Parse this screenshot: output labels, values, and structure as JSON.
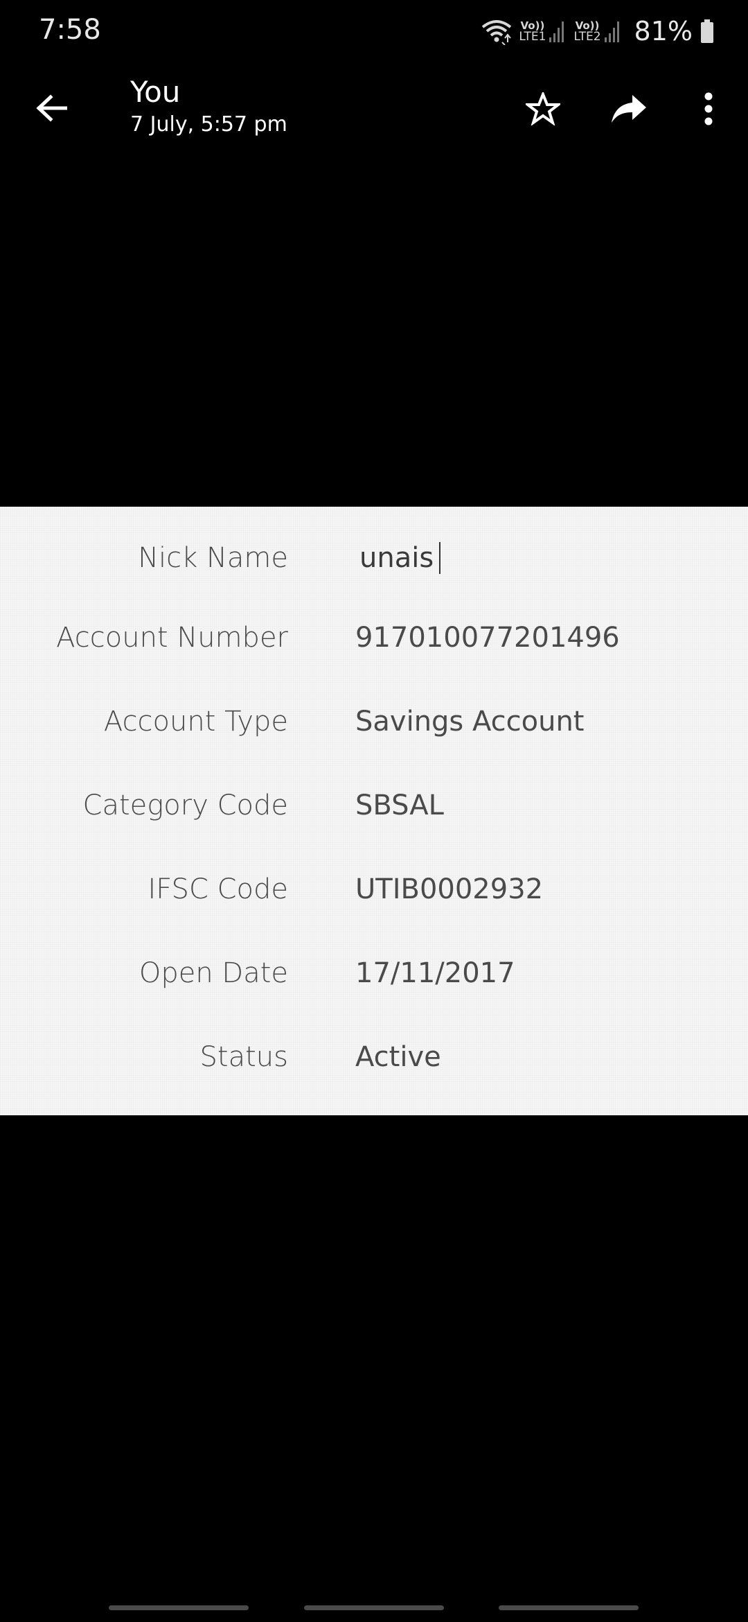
{
  "status_bar": {
    "time": "7:58",
    "sim1_vo": "Vo))",
    "sim1_lte": "LTE1",
    "sim2_vo": "Vo))",
    "sim2_lte": "LTE2",
    "battery": "81%",
    "icons": [
      "wifi-icon",
      "signal-icon",
      "signal-icon",
      "battery-icon"
    ]
  },
  "toolbar": {
    "sender": "You",
    "timestamp": "7 July, 5:57 pm",
    "icons": [
      "back-arrow-icon",
      "star-icon",
      "share-icon",
      "more-vert-icon"
    ]
  },
  "details": {
    "nick_name": {
      "label": "Nick Name",
      "value": "unais"
    },
    "rows": [
      {
        "label": "Account Number",
        "value": "917010077201496"
      },
      {
        "label": "Account Type",
        "value": "Savings Account"
      },
      {
        "label": "Category Code",
        "value": "SBSAL"
      },
      {
        "label": "IFSC Code",
        "value": "UTIB0002932"
      },
      {
        "label": "Open Date",
        "value": "17/11/2017"
      },
      {
        "label": "Status",
        "value": "Active"
      }
    ]
  },
  "colors": {
    "background": "#000000",
    "card": "#f6f6f6",
    "text_dark": "#4a4a4a",
    "toolbar_text": "#ffffff"
  }
}
